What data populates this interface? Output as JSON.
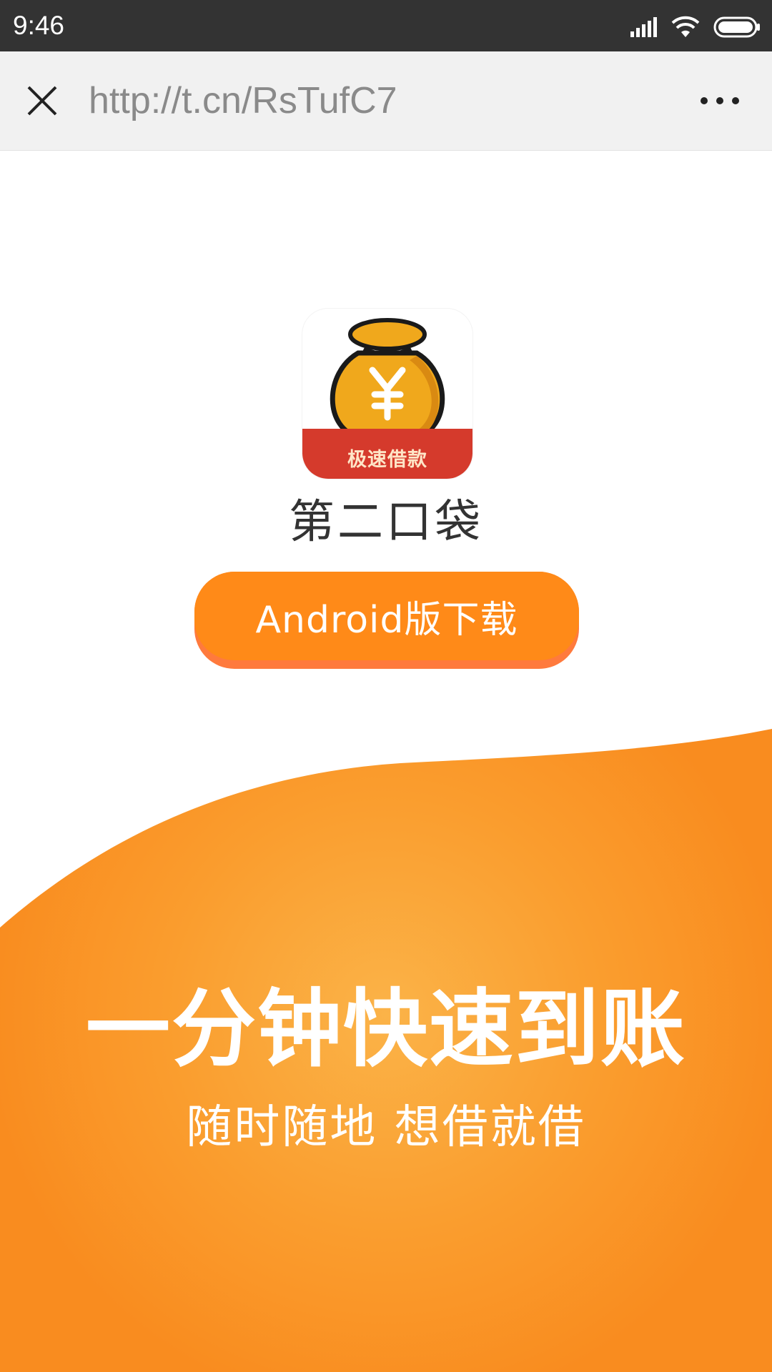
{
  "status_bar": {
    "time": "9:46",
    "icons": [
      "signal-icon",
      "wifi-icon",
      "battery-icon"
    ]
  },
  "toolbar": {
    "url": "http://t.cn/RsTufC7",
    "close_icon": "close-icon",
    "more_icon": "more-icon"
  },
  "app": {
    "icon_label": "极速借款",
    "icon_symbol": "¥",
    "name": "第二口袋"
  },
  "download": {
    "label": "Android版下载"
  },
  "banner": {
    "headline": "一分钟快速到账",
    "subtitle": "随时随地 想借就借"
  },
  "colors": {
    "status_bar": "#333333",
    "toolbar": "#f1f1f1",
    "accent_orange": "#ff8a18",
    "icon_red": "#d53a2c",
    "bag_gold": "#f0a81c"
  }
}
